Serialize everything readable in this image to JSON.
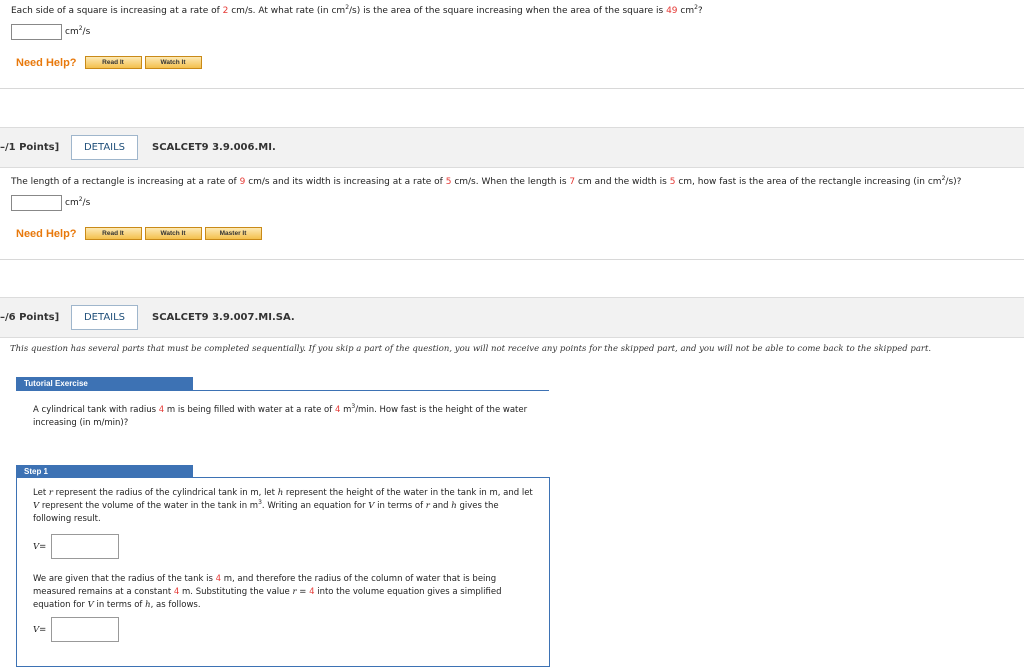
{
  "q1": {
    "text_a": "Each side of a square is increasing at a rate of ",
    "rate": "2",
    "text_b": " cm/s. At what rate (in cm",
    "exp": "2",
    "text_c": "/s) is the area of the square increasing when the area of the square is ",
    "area": "49",
    "text_d": " cm",
    "exp2": "2",
    "text_e": "?",
    "unit_base": "cm",
    "unit_exp": "2",
    "unit_tail": "/s"
  },
  "help": {
    "label": "Need Help?",
    "read": "Read It",
    "watch": "Watch It",
    "master": "Master It"
  },
  "q2": {
    "points": "–/1 Points]",
    "details": "DETAILS",
    "id": "SCALCET9 3.9.006.MI.",
    "text_a": "The length of a rectangle is increasing at a rate of ",
    "r1": "9",
    "text_b": " cm/s and its width is increasing at a rate of ",
    "r2": "5",
    "text_c": " cm/s. When the length is ",
    "len": "7",
    "text_d": " cm and the width is ",
    "wid": "5",
    "text_e": " cm, how fast is the area of the rectangle increasing (in cm",
    "exp": "2",
    "text_f": "/s)?",
    "unit_base": "cm",
    "unit_exp": "2",
    "unit_tail": "/s"
  },
  "q3": {
    "points": "–/6 Points]",
    "details": "DETAILS",
    "id": "SCALCET9 3.9.007.MI.SA.",
    "note": "This question has several parts that must be completed sequentially. If you skip a part of the question, you will not receive any points for the skipped part, and you will not be able to come back to the skipped part.",
    "tutorial_title": "Tutorial Exercise",
    "tut_a": "A cylindrical tank with radius ",
    "tut_r": "4",
    "tut_b": " m is being filled with water at a rate of ",
    "tut_rate": "4",
    "tut_c": " m",
    "tut_exp": "3",
    "tut_d": "/min. How fast is the height of the water increasing (in m/min)?",
    "step_title": "Step 1",
    "s1_a": "Let ",
    "s1_r": "r",
    "s1_b": " represent the radius of the cylindrical tank in m, let ",
    "s1_h": "h",
    "s1_c": " represent the height of the water in the tank in m, and let ",
    "s1_v": "V",
    "s1_d": " represent the volume of the water in the tank in m",
    "s1_exp": "3",
    "s1_e": ". Writing an equation for ",
    "s1_v2": "V",
    "s1_f": " in terms of ",
    "s1_r2": "r",
    "s1_g": " and ",
    "s1_h2": "h",
    "s1_h_end": " gives the following result.",
    "v_label": "V",
    "eq": " =",
    "s2_a": "We are given that the radius of the tank is ",
    "s2_r": "4",
    "s2_b": " m, and therefore the radius of the column of water that is being measured remains at a constant ",
    "s2_r2": "4",
    "s2_c": " m. Substituting the value ",
    "s2_rv": "r",
    "s2_d": " = ",
    "s2_r3": "4",
    "s2_e": " into the volume equation gives a simplified equation for ",
    "s2_v": "V",
    "s2_f": " in terms of ",
    "s2_h": "h",
    "s2_g": ", as follows."
  },
  "colors": {
    "accent": "#3d72b4",
    "highlight": "#e53935",
    "help": "#e8790c"
  }
}
